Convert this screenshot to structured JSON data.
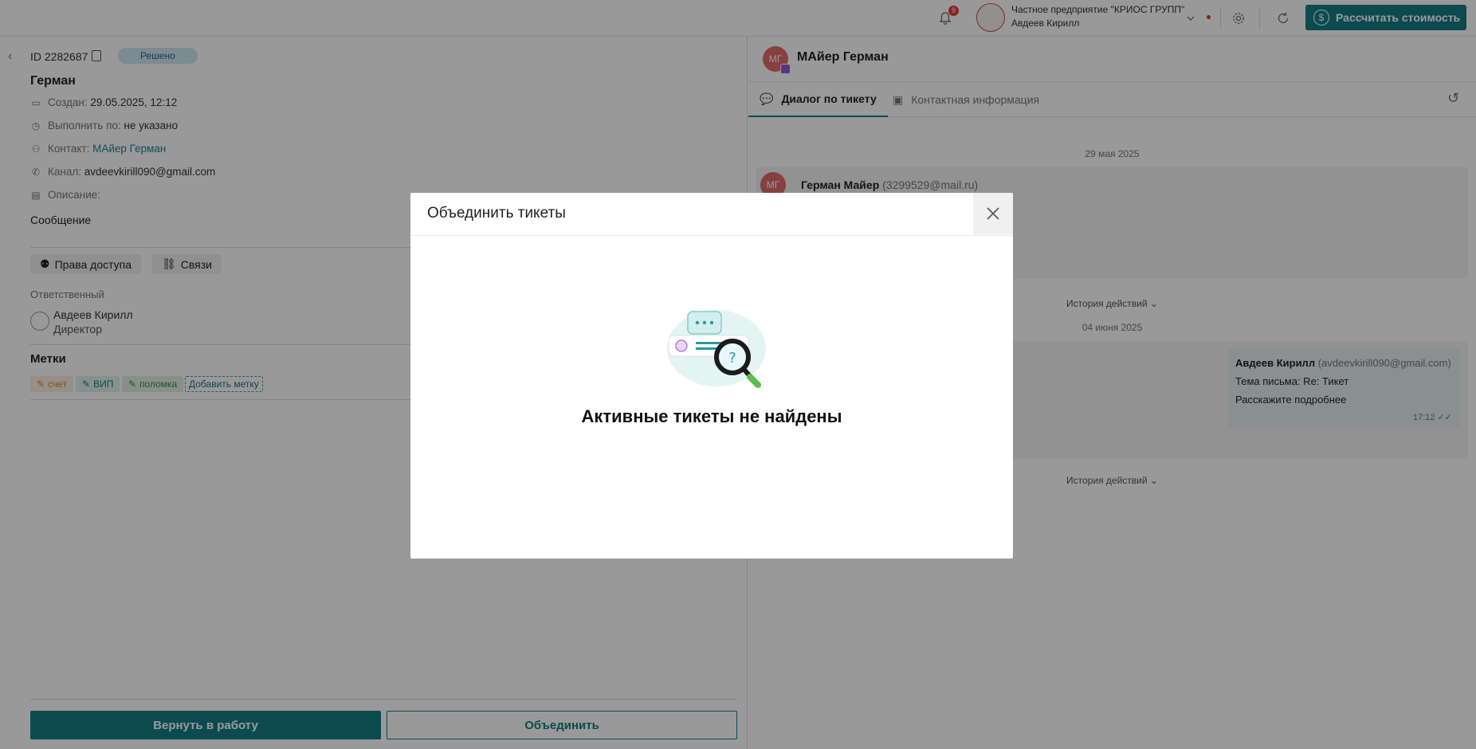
{
  "topbar": {
    "notification_count": "9",
    "org_name": "Частное предприятие \"КРИОС ГРУПП\"",
    "user_name": "Авдеев Кирилл",
    "calc_button": "Рассчитать стоимость"
  },
  "ticket": {
    "id": "ID 2282687",
    "status": "Решено",
    "title": "Герман",
    "created_label": "Создан:",
    "created_value": "29.05.2025, 12:12",
    "due_label": "Выполнить по:",
    "due_value": "не указано",
    "contact_label": "Контакт:",
    "contact_value": "МАйер Герман",
    "channel_label": "Канал:",
    "channel_value": "avdeevkirill090@gmail.com",
    "description_label": "Описание:",
    "description_value": "Сообщение",
    "access_button": "Права доступа",
    "links_button": "Связи",
    "responsible_label": "Ответственный",
    "responsible_name": "Авдеев Кирилл",
    "responsible_role": "Директор",
    "tags_title": "Метки",
    "tags": [
      "счет",
      "ВИП",
      "поломка"
    ],
    "add_tag": "Добавить метку",
    "return_button": "Вернуть в работу",
    "merge_button": "Объединить"
  },
  "chat": {
    "contact_initials": "МГ",
    "contact_name": "МАйер Герман",
    "tab_dialog": "Диалог по тикету",
    "tab_contact": "Контактная информация",
    "date1": "29 мая 2025",
    "sender1_name": "Герман Майер",
    "sender1_email": "(3299529@mail.ru)",
    "history1": "История действий",
    "date2": "04 июня 2025",
    "reply_name": "Авдеев Кирилл",
    "reply_email": "(avdeevkirill090@gmail.com)",
    "reply_subject": "Тема письма: Re: Тикет",
    "reply_body": "Расскажите подробнее",
    "reply_time": "17:12",
    "history2": "История действий"
  },
  "modal": {
    "title": "Объединить тикеты",
    "empty_text": "Активные тикеты не найдены"
  },
  "colors": {
    "accent": "#137d84",
    "link": "#1c7fa0",
    "badge_bg": "#cfe7f3"
  }
}
